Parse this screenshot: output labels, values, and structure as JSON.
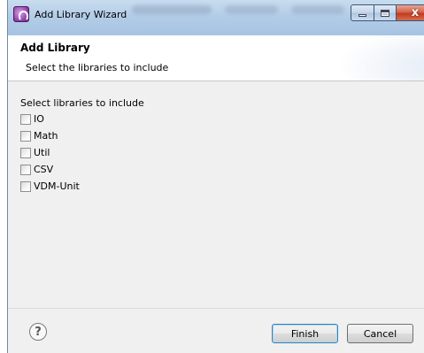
{
  "window": {
    "title": "Add Library Wizard",
    "controls": {
      "minimize_icon": "minimize-icon",
      "maximize_icon": "maximize-icon",
      "close_icon": "close-icon",
      "close_glyph": "x"
    }
  },
  "banner": {
    "title": "Add Library",
    "description": "Select the libraries to include"
  },
  "content": {
    "section_label": "Select libraries to include",
    "libraries": [
      {
        "label": "IO",
        "checked": false
      },
      {
        "label": "Math",
        "checked": false
      },
      {
        "label": "Util",
        "checked": false
      },
      {
        "label": "CSV",
        "checked": false
      },
      {
        "label": "VDM-Unit",
        "checked": false
      }
    ]
  },
  "footer": {
    "help_glyph": "?",
    "finish_label": "Finish",
    "cancel_label": "Cancel"
  },
  "colors": {
    "titlebar": "#b3cde7",
    "accent_button_border": "#3c7fb1",
    "close_button": "#c23c1e"
  }
}
